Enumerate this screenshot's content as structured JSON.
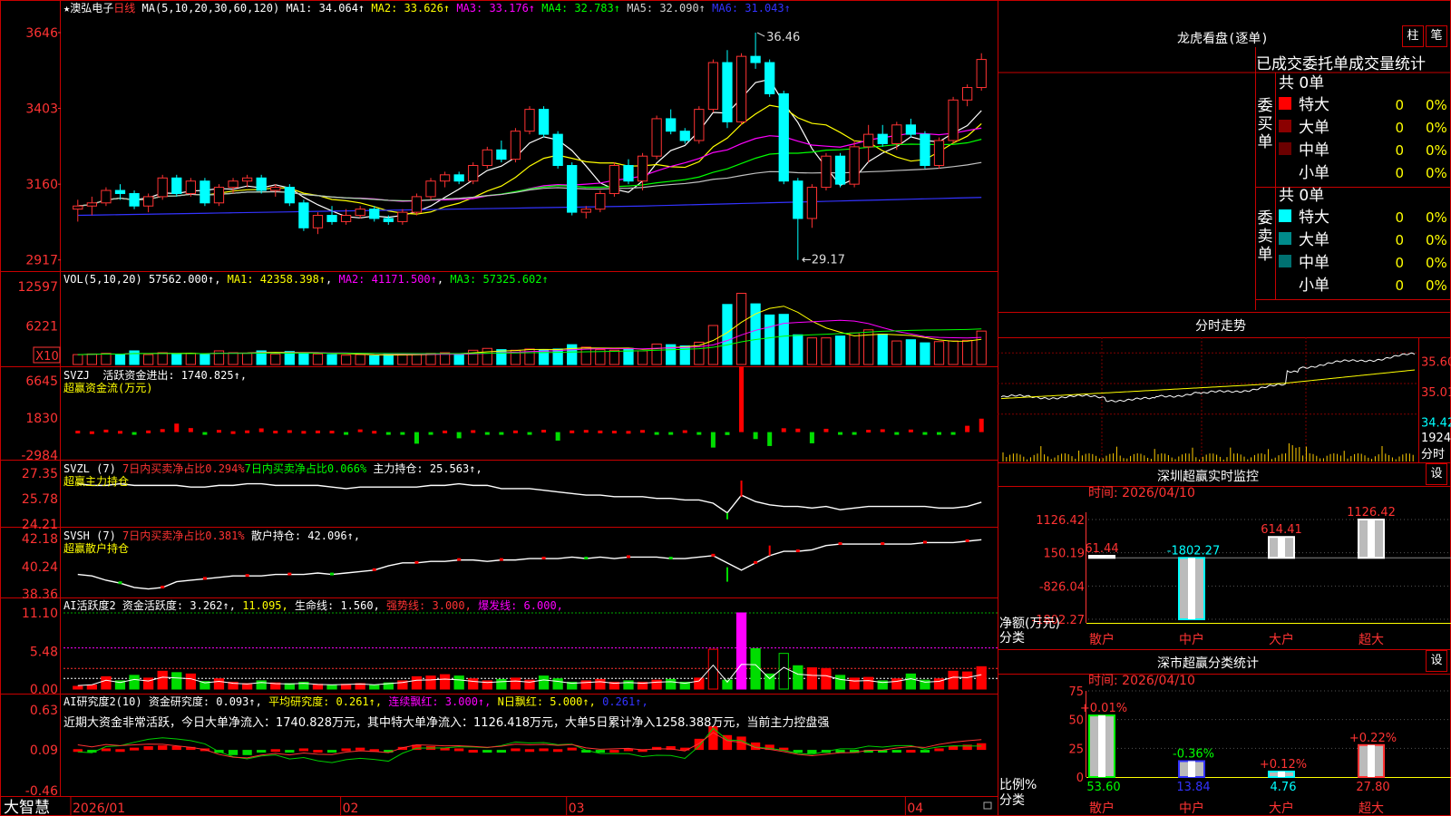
{
  "app": {
    "brand": "大智慧"
  },
  "stock": {
    "star": "★",
    "name": "澳弘电子",
    "period": "日线"
  },
  "main": {
    "ma_label": "MA(5,10,20,30,60,120)",
    "ma1": "MA1: 34.064↑",
    "ma2": "MA2: 33.626↑",
    "ma3": "MA3: 33.176↑",
    "ma4": "MA4: 32.783↑",
    "ma5": "MA5: 32.090↑",
    "ma6": "MA6: 31.043↑",
    "high_marker": "36.46",
    "low_marker": "29.17",
    "price_ticks": [
      "3646",
      "3403",
      "3160",
      "2917"
    ],
    "colors": {
      "ma1": "#ffffff",
      "ma2": "#ffff00",
      "ma3": "#ff00ff",
      "ma4": "#00ff00",
      "ma5": "#c0c0c0",
      "ma6": "#3333ff"
    }
  },
  "vol": {
    "label": "VOL(5,10,20)",
    "value": "57562.000↑",
    "ma1": "MA1: 42358.398↑",
    "ma2": "MA2: 41171.500↑",
    "ma3": "MA3: 57325.602↑",
    "ticks": [
      "12597",
      "6221"
    ],
    "unit": "X10"
  },
  "svzj": {
    "label": "SVZJ",
    "text": "活跃资金进出: 1740.825↑,",
    "subtitle": "超赢资金流(万元)",
    "ticks": [
      "6645",
      "1830",
      "-2984"
    ]
  },
  "svzl": {
    "label": "SVZL (7)",
    "red_text": "7日内买卖净占比0.294%",
    "green_text": "7日内买卖净占比0.066%",
    "white_text": "主力持仓: 25.563↑,",
    "subtitle": "超赢主力持仓",
    "ticks": [
      "27.35",
      "25.78",
      "24.21"
    ]
  },
  "svsh": {
    "label": "SVSH (7)",
    "red_text": "7日内买卖净占比0.381%",
    "white_text": "散户持仓: 42.096↑,",
    "subtitle": "超赢散户持仓",
    "ticks": [
      "42.18",
      "40.24",
      "38.36"
    ]
  },
  "ai2": {
    "label": "AI活跃度2",
    "t1": "资金活跃度: 3.262↑,",
    "t2": "11.095,",
    "t3": "生命线: 1.560,",
    "t4": "强势线: 3.000,",
    "t5": "爆发线: 6.000,",
    "ticks": [
      "11.10",
      "5.48",
      "0.00"
    ]
  },
  "ai10": {
    "label": "AI研究度2(10)",
    "t1": "资金研究度: 0.093↑,",
    "t2": "平均研究度: 0.261↑,",
    "t3": "连续飘红: 3.000↑,",
    "t4": "N日飘红: 5.000↑,",
    "t5": "0.261↑,",
    "comment": "近期大资金非常活跃，今日大单净流入：1740.828万元，其中特大单净流入：1126.418万元，大单5日累计净入1258.388万元，当前主力控盘强",
    "ticks": [
      "0.63",
      "0.09",
      "-0.46"
    ]
  },
  "xaxis": {
    "labels": [
      "2026/01",
      "02",
      "03",
      "04"
    ]
  },
  "dragon": {
    "title": "龙虎看盘(逐单)",
    "btn1": "柱",
    "btn2": "笔",
    "header": "已成交委托单成交量统计",
    "buy_label": "委买单",
    "sell_label": "委卖单",
    "buy_total": "共 0单",
    "sell_total": "共 0单",
    "buy_rows": [
      {
        "name": "特大",
        "count": "0",
        "pct": "0%",
        "color": "#ff0000"
      },
      {
        "name": "大单",
        "count": "0",
        "pct": "0%",
        "color": "#8b0000"
      },
      {
        "name": "中单",
        "count": "0",
        "pct": "0%",
        "color": "#6b0000"
      },
      {
        "name": "小单",
        "count": "0",
        "pct": "0%",
        "color": ""
      }
    ],
    "sell_rows": [
      {
        "name": "特大",
        "count": "0",
        "pct": "0%",
        "color": "#00ffff"
      },
      {
        "name": "大单",
        "count": "0",
        "pct": "0%",
        "color": "#008b8b"
      },
      {
        "name": "中单",
        "count": "0",
        "pct": "0%",
        "color": "#007070"
      },
      {
        "name": "小单",
        "count": "0",
        "pct": "0%",
        "color": ""
      }
    ]
  },
  "intraday": {
    "title": "分时走势",
    "prices": [
      "35.60",
      "35.01",
      "34.42"
    ],
    "vol": "1924",
    "vol_unit": "分时"
  },
  "monitor": {
    "title": "深圳超赢实时监控",
    "btn": "设",
    "time": "时间: 2026/04/10",
    "y_label": "净额(万元)",
    "x_label": "分类",
    "ticks": [
      "1126.42",
      "150.19",
      "-826.04",
      "-1802.27"
    ],
    "categories": [
      "散户",
      "中户",
      "大户",
      "超大"
    ],
    "values": [
      61.44,
      -1802.27,
      614.41,
      1126.42
    ],
    "value_labels": [
      "61.44",
      "-1802.27",
      "614.41",
      "1126.42"
    ]
  },
  "classify": {
    "title": "深市超赢分类统计",
    "btn": "设",
    "time": "时间: 2026/04/10",
    "y_label": "比例%",
    "x_label": "分类",
    "ticks": [
      "75",
      "50",
      "25",
      "0"
    ],
    "categories": [
      "散户",
      "中户",
      "大户",
      "超大"
    ],
    "values": [
      53.6,
      13.84,
      4.76,
      27.8
    ],
    "value_labels": [
      "53.60",
      "13.84",
      "4.76",
      "27.80"
    ],
    "changes": [
      "+0.01%",
      "-0.36%",
      "+0.12%",
      "+0.22%"
    ]
  },
  "chart_data": {
    "type": "candlestick",
    "candles": [
      [
        30.8,
        31.1,
        30.4,
        30.9
      ],
      [
        30.9,
        31.2,
        30.6,
        31.0
      ],
      [
        31.0,
        31.5,
        30.9,
        31.4
      ],
      [
        31.4,
        31.6,
        31.1,
        31.3
      ],
      [
        31.3,
        31.4,
        30.8,
        30.9
      ],
      [
        30.9,
        31.3,
        30.7,
        31.2
      ],
      [
        31.2,
        31.9,
        31.1,
        31.8
      ],
      [
        31.8,
        31.9,
        31.2,
        31.3
      ],
      [
        31.3,
        31.8,
        31.2,
        31.7
      ],
      [
        31.7,
        31.8,
        30.9,
        31.0
      ],
      [
        31.0,
        31.6,
        30.9,
        31.5
      ],
      [
        31.5,
        31.8,
        31.3,
        31.7
      ],
      [
        31.7,
        31.9,
        31.5,
        31.8
      ],
      [
        31.8,
        31.9,
        31.3,
        31.4
      ],
      [
        31.4,
        31.6,
        31.2,
        31.5
      ],
      [
        31.5,
        31.6,
        30.9,
        31.0
      ],
      [
        31.0,
        31.1,
        30.1,
        30.2
      ],
      [
        30.2,
        30.7,
        30.0,
        30.6
      ],
      [
        30.6,
        30.9,
        30.3,
        30.4
      ],
      [
        30.4,
        30.8,
        30.3,
        30.6
      ],
      [
        30.6,
        30.9,
        30.5,
        30.8
      ],
      [
        30.8,
        30.9,
        30.4,
        30.5
      ],
      [
        30.5,
        30.6,
        30.3,
        30.4
      ],
      [
        30.4,
        30.8,
        30.3,
        30.7
      ],
      [
        30.7,
        31.3,
        30.6,
        31.2
      ],
      [
        31.2,
        31.8,
        31.1,
        31.7
      ],
      [
        31.7,
        32.0,
        31.5,
        31.9
      ],
      [
        31.9,
        32.0,
        31.6,
        31.7
      ],
      [
        31.7,
        32.3,
        31.6,
        32.2
      ],
      [
        32.2,
        32.8,
        32.1,
        32.7
      ],
      [
        32.7,
        33.0,
        32.3,
        32.4
      ],
      [
        32.4,
        33.4,
        32.3,
        33.3
      ],
      [
        33.3,
        34.1,
        33.2,
        34.0
      ],
      [
        34.0,
        34.1,
        33.1,
        33.2
      ],
      [
        33.2,
        33.3,
        32.1,
        32.2
      ],
      [
        32.2,
        32.3,
        30.6,
        30.7
      ],
      [
        30.7,
        30.9,
        30.5,
        30.8
      ],
      [
        30.8,
        31.4,
        30.7,
        31.3
      ],
      [
        31.3,
        32.3,
        31.2,
        32.2
      ],
      [
        32.2,
        32.4,
        31.6,
        31.7
      ],
      [
        31.7,
        32.6,
        31.4,
        32.5
      ],
      [
        32.5,
        33.8,
        32.4,
        33.7
      ],
      [
        33.7,
        34.0,
        33.2,
        33.3
      ],
      [
        33.3,
        33.4,
        32.9,
        33.0
      ],
      [
        33.0,
        34.1,
        32.9,
        34.0
      ],
      [
        34.0,
        35.6,
        33.9,
        35.5
      ],
      [
        35.5,
        35.9,
        33.4,
        33.6
      ],
      [
        33.6,
        35.8,
        33.5,
        35.7
      ],
      [
        35.7,
        36.46,
        35.3,
        35.5
      ],
      [
        35.5,
        35.6,
        34.4,
        34.5
      ],
      [
        34.5,
        34.6,
        31.6,
        31.7
      ],
      [
        31.7,
        31.8,
        29.17,
        30.5
      ],
      [
        30.5,
        31.6,
        30.2,
        31.5
      ],
      [
        31.5,
        32.6,
        31.4,
        32.5
      ],
      [
        32.5,
        32.6,
        31.5,
        31.6
      ],
      [
        31.6,
        33.0,
        31.5,
        32.8
      ],
      [
        32.8,
        33.5,
        32.3,
        33.2
      ],
      [
        33.2,
        33.5,
        32.8,
        32.9
      ],
      [
        32.9,
        33.6,
        32.7,
        33.5
      ],
      [
        33.5,
        33.7,
        33.1,
        33.2
      ],
      [
        33.2,
        33.3,
        32.1,
        32.2
      ],
      [
        32.2,
        33.1,
        32.1,
        33.0
      ],
      [
        33.0,
        34.4,
        32.9,
        34.3
      ],
      [
        34.3,
        34.8,
        34.1,
        34.7
      ],
      [
        34.7,
        35.8,
        34.6,
        35.6
      ]
    ],
    "volume": [
      1.6,
      1.7,
      1.8,
      1.6,
      2.2,
      1.6,
      1.9,
      1.7,
      1.8,
      1.6,
      2.2,
      1.9,
      1.8,
      2.2,
      1.7,
      2.1,
      1.9,
      1.7,
      1.6,
      1.5,
      1.6,
      1.4,
      1.6,
      1.6,
      1.7,
      1.8,
      1.9,
      1.7,
      2.3,
      2.6,
      2.4,
      2.3,
      2.5,
      2.4,
      2.5,
      3.2,
      2.8,
      2.4,
      2.3,
      2.6,
      2.2,
      3.3,
      3.2,
      3.0,
      3.6,
      6.3,
      9.7,
      11.5,
      9.8,
      8.0,
      8.1,
      4.8,
      4.3,
      4.3,
      4.6,
      5.1,
      5.6,
      4.9,
      3.8,
      4.0,
      3.5,
      3.7,
      3.8,
      3.9,
      5.4
    ],
    "svzj": [
      180,
      100,
      320,
      150,
      -250,
      210,
      390,
      1100,
      520,
      -300,
      280,
      110,
      220,
      480,
      180,
      250,
      150,
      200,
      180,
      -160,
      350,
      160,
      -320,
      -300,
      -1500,
      -280,
      200,
      -800,
      250,
      -300,
      -180,
      210,
      -250,
      300,
      -1100,
      210,
      280,
      200,
      180,
      150,
      270,
      -160,
      -210,
      240,
      -180,
      -2000,
      -380,
      8500,
      -900,
      -1800,
      500,
      450,
      -1450,
      430,
      -250,
      -250,
      300,
      370,
      -280,
      330,
      -280,
      -260,
      -280,
      820,
      1740
    ],
    "ai_active": [
      0.4,
      0.6,
      1.8,
      1.2,
      2.0,
      1.6,
      2.6,
      2.4,
      2.2,
      1.1,
      1.5,
      1.0,
      0.8,
      1.2,
      0.9,
      0.8,
      1.0,
      0.7,
      0.6,
      0.7,
      0.8,
      0.6,
      0.9,
      1.2,
      1.8,
      1.9,
      2.1,
      1.9,
      1.5,
      1.2,
      1.4,
      1.6,
      1.3,
      1.9,
      1.5,
      1.0,
      1.2,
      1.4,
      1.0,
      1.2,
      1.0,
      1.3,
      1.4,
      1.0,
      1.6,
      5.8,
      1.3,
      11.1,
      5.9,
      2.2,
      5.2,
      3.4,
      3.1,
      3.0,
      2.0,
      1.6,
      1.7,
      1.2,
      1.5,
      2.2,
      1.3,
      1.5,
      2.6,
      2.5,
      3.26
    ],
    "ai_research": [
      0.01,
      -0.02,
      0.02,
      0.01,
      0.03,
      0.05,
      0.06,
      0.05,
      0.04,
      0.02,
      -0.04,
      -0.07,
      -0.07,
      -0.02,
      0.01,
      -0.01,
      0.02,
      0.0,
      -0.01,
      0.02,
      0.03,
      0.01,
      -0.02,
      0.04,
      0.07,
      0.05,
      0.03,
      0.02,
      0.0,
      -0.02,
      -0.01,
      0.02,
      0.01,
      0.02,
      0.01,
      0.03,
      -0.01,
      -0.02,
      0.0,
      0.02,
      0.01,
      0.04,
      0.05,
      0.03,
      0.15,
      0.32,
      0.2,
      0.18,
      0.1,
      0.07,
      0.03,
      -0.02,
      -0.05,
      -0.04,
      -0.03,
      -0.04,
      -0.02,
      -0.03,
      -0.01,
      0.0,
      -0.02,
      0.02,
      0.05,
      0.07,
      0.09
    ],
    "svzl": [
      26.7,
      26.6,
      26.6,
      26.7,
      26.6,
      26.6,
      26.6,
      26.6,
      26.5,
      26.5,
      26.6,
      26.6,
      26.7,
      26.7,
      26.6,
      26.6,
      26.6,
      26.6,
      26.5,
      26.4,
      26.5,
      26.5,
      26.5,
      26.5,
      26.5,
      26.6,
      26.6,
      26.7,
      26.6,
      26.6,
      26.4,
      26.4,
      26.4,
      26.3,
      26.2,
      26.1,
      26.0,
      26.0,
      25.9,
      25.9,
      25.9,
      25.8,
      25.8,
      25.7,
      25.7,
      25.5,
      24.9,
      26.0,
      25.6,
      25.4,
      25.3,
      25.3,
      25.2,
      25.3,
      25.1,
      25.2,
      25.3,
      25.3,
      25.3,
      25.3,
      25.3,
      25.2,
      25.2,
      25.3,
      25.56
    ],
    "svsh": [
      39.7,
      39.6,
      39.3,
      39.1,
      38.8,
      38.7,
      38.8,
      39.2,
      39.3,
      39.4,
      39.5,
      39.6,
      39.6,
      39.6,
      39.7,
      39.7,
      39.7,
      39.8,
      39.7,
      39.8,
      39.9,
      40.0,
      40.3,
      40.5,
      40.5,
      40.6,
      40.6,
      40.7,
      40.7,
      40.6,
      40.7,
      40.7,
      40.8,
      40.8,
      40.8,
      40.9,
      40.8,
      40.9,
      40.8,
      40.9,
      40.9,
      40.9,
      40.8,
      40.8,
      40.9,
      41.0,
      40.5,
      40.0,
      40.5,
      41.0,
      41.3,
      41.3,
      41.4,
      41.7,
      41.8,
      41.8,
      41.8,
      41.8,
      41.8,
      41.8,
      41.9,
      41.9,
      41.9,
      42.0,
      42.096
    ]
  }
}
